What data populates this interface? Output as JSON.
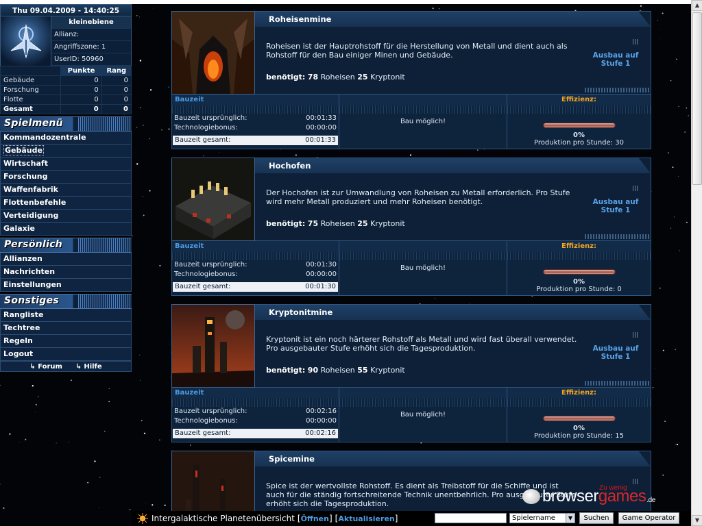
{
  "sidebar": {
    "datetime": "Thu 09.04.2009 - 14:40:25",
    "username": "kleinebiene",
    "allianz": "Allianz:",
    "angriffszone": "Angriffszone: 1",
    "userid": "UserID: 50960",
    "stats": {
      "col_points": "Punkte",
      "col_rank": "Rang",
      "rows": [
        {
          "label": "Gebäude",
          "points": "0",
          "rank": "0"
        },
        {
          "label": "Forschung",
          "points": "0",
          "rank": "0"
        },
        {
          "label": "Flotte",
          "points": "0",
          "rank": "0"
        },
        {
          "label": "Gesamt",
          "points": "0",
          "rank": "0"
        }
      ]
    },
    "sections": [
      {
        "title": "Spielmenü",
        "items": [
          "Kommandozentrale",
          "Gebäude",
          "Wirtschaft",
          "Forschung",
          "Waffenfabrik",
          "Flottenbefehle",
          "Verteidigung",
          "Galaxie"
        ]
      },
      {
        "title": "Persönlich",
        "items": [
          "Allianzen",
          "Nachrichten",
          "Einstellungen"
        ]
      },
      {
        "title": "Sonstiges",
        "items": [
          "Rangliste",
          "Techtree",
          "Regeln",
          "Logout"
        ]
      }
    ],
    "footer": {
      "forum": "Forum",
      "help": "Hilfe"
    }
  },
  "labels": {
    "bauzeit": "Bauzeit",
    "original": "Bauzeit ursprünglich:",
    "bonus": "Technologiebonus:",
    "total": "Bauzeit gesamt:",
    "possible": "Bau möglich!",
    "efficiency": "Effizienz:",
    "production_prefix": "Produktion pro Stunde: ",
    "needed": "benötigt:",
    "res1": "Roheisen",
    "res2": "Kryptonit",
    "upgrade": "Ausbau auf Stufe 1"
  },
  "buildings": [
    {
      "name": "Roheisenmine",
      "description": "Roheisen ist der Hauptrohstoff für die Herstellung von Metall und dient auch als Rohstoff für den Bau einiger Minen und Gebäude.",
      "cost1": "78",
      "cost2": "25",
      "time_original": "00:01:33",
      "time_bonus": "00:00:00",
      "time_total": "00:01:33",
      "efficiency": "0%",
      "production": "30"
    },
    {
      "name": "Hochofen",
      "description": "Der Hochofen ist zur Umwandlung von Roheisen zu Metall erforderlich. Pro Stufe wird mehr Metall produziert und mehr Roheisen benötigt.",
      "cost1": "75",
      "cost2": "25",
      "time_original": "00:01:30",
      "time_bonus": "00:00:00",
      "time_total": "00:01:30",
      "efficiency": "0%",
      "production": "0"
    },
    {
      "name": "Kryptonitmine",
      "description": "Kryptonit ist ein noch härterer Rohstoff als Metall und wird fast überall verwendet. Pro ausgebauter Stufe erhöht sich die Tagesproduktion.",
      "cost1": "90",
      "cost2": "55",
      "time_original": "00:02:16",
      "time_bonus": "00:00:00",
      "time_total": "00:02:16",
      "efficiency": "0%",
      "production": "15"
    },
    {
      "name": "Spicemine",
      "description": "Spice ist der wertvollste Rohstoff. Es dient als Treibstoff für die Schiffe und ist auch für die ständig fortschreitende Technik unentbehrlich. Pro ausgebauter Stufe erhöht sich die Tagesproduktion."
    }
  ],
  "bottombar": {
    "title": "Intergalaktische Planetenübersicht",
    "open": "Öffnen",
    "refresh": "Aktualisieren",
    "select_value": "Spielername",
    "search": "Suchen",
    "operator": "Game Operator"
  },
  "watermark": {
    "small": "Zu wenig",
    "part1": "browser",
    "part2": "games",
    "tld": ".de"
  },
  "colors": {
    "panel": "#0d2038",
    "link": "#4e9be0",
    "efficiency": "#f5a623"
  }
}
